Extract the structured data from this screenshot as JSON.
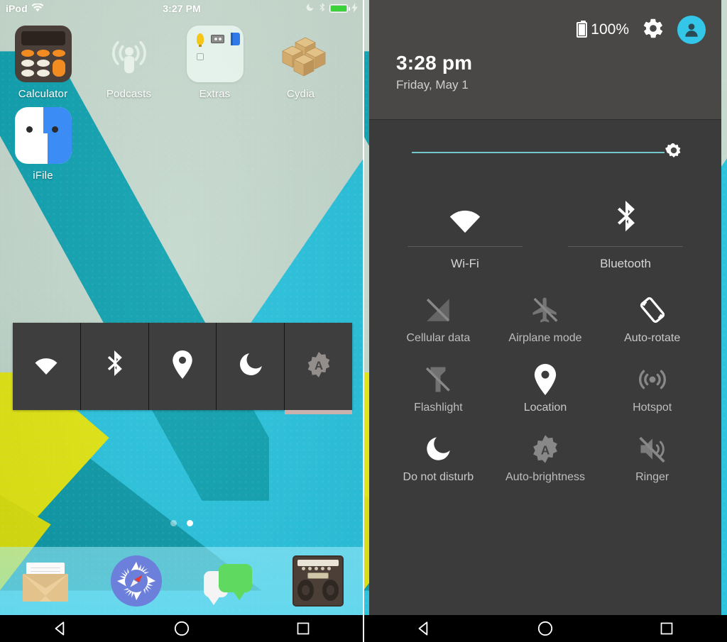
{
  "left_panel": {
    "status_bar": {
      "carrier": "iPod",
      "wifi_icon": "wifi-icon",
      "time": "3:27 PM",
      "dnd_icon": "crescent-moon-icon",
      "bluetooth_icon": "bluetooth-icon",
      "battery_icon": "battery-full-icon",
      "charging_icon": "lightning-bolt-icon"
    },
    "home_icons": [
      {
        "label": "Calculator",
        "icon": "calculator-icon"
      },
      {
        "label": "Podcasts",
        "icon": "podcasts-icon"
      },
      {
        "label": "Extras",
        "icon": "folder-icon"
      },
      {
        "label": "Cydia",
        "icon": "cydia-boxes-icon"
      },
      {
        "label": "iFile",
        "icon": "ifile-icon"
      }
    ],
    "folder_contents": [
      {
        "name": "lightbulb-icon"
      },
      {
        "name": "voice-memos-cassette-icon"
      },
      {
        "name": "ibooks-icon"
      },
      {
        "name": "empty-app-placeholder-icon"
      }
    ],
    "toggle_strip": [
      {
        "name": "wifi-toggle",
        "icon": "wifi-icon",
        "state": "on"
      },
      {
        "name": "bluetooth-toggle",
        "icon": "bluetooth-icon",
        "state": "on"
      },
      {
        "name": "location-toggle",
        "icon": "location-pin-icon",
        "state": "on"
      },
      {
        "name": "do-not-disturb-toggle",
        "icon": "crescent-moon-icon",
        "state": "on"
      },
      {
        "name": "auto-brightness-toggle",
        "icon": "auto-brightness-icon",
        "state": "off"
      }
    ],
    "page_dots": {
      "total": 2,
      "active_index": 1
    },
    "dock": [
      {
        "label": "Mail",
        "icon": "mail-envelope-icon"
      },
      {
        "label": "Safari",
        "icon": "safari-compass-icon"
      },
      {
        "label": "Messages",
        "icon": "messages-bubble-icon"
      },
      {
        "label": "Music",
        "icon": "boombox-radio-icon"
      }
    ]
  },
  "right_panel": {
    "header": {
      "battery_percent": "100%",
      "battery_icon": "battery-charging-icon",
      "settings_icon": "gear-icon",
      "avatar_icon": "user-avatar-icon",
      "time": "3:28 pm",
      "date": "Friday, May 1"
    },
    "brightness": {
      "name": "brightness-slider",
      "thumb_icon": "sun-icon",
      "value_percent": 93
    },
    "big_tiles": [
      {
        "label": "Wi-Fi",
        "icon": "wifi-icon",
        "state": "on"
      },
      {
        "label": "Bluetooth",
        "icon": "bluetooth-icon",
        "state": "on"
      }
    ],
    "tiles": [
      {
        "label": "Cellular data",
        "icon": "cellular-off-icon",
        "state": "off"
      },
      {
        "label": "Airplane mode",
        "icon": "airplane-off-icon",
        "state": "off"
      },
      {
        "label": "Auto-rotate",
        "icon": "auto-rotate-icon",
        "state": "on"
      },
      {
        "label": "Flashlight",
        "icon": "flashlight-off-icon",
        "state": "off"
      },
      {
        "label": "Location",
        "icon": "location-pin-icon",
        "state": "on"
      },
      {
        "label": "Hotspot",
        "icon": "hotspot-icon",
        "state": "off"
      },
      {
        "label": "Do not disturb",
        "icon": "crescent-moon-icon",
        "state": "on"
      },
      {
        "label": "Auto-brightness",
        "icon": "auto-brightness-icon",
        "state": "off"
      },
      {
        "label": "Ringer",
        "icon": "ringer-muted-icon",
        "state": "off"
      }
    ]
  },
  "nav_bar": [
    {
      "name": "back-button",
      "icon": "triangle-back-icon"
    },
    {
      "name": "home-button",
      "icon": "circle-home-icon"
    },
    {
      "name": "recents-button",
      "icon": "square-recents-icon"
    }
  ],
  "colors": {
    "wallpaper_sage": "#c6d9ce",
    "wallpaper_teal": "#12a2b0",
    "wallpaper_cyan": "#2bc3dd",
    "wallpaper_yellow": "#e0e515",
    "panel_dark": "#3b3b3b",
    "panel_header": "#494846",
    "accent_cyan": "#34c6e8",
    "slider_fill": "#73c6c9",
    "battery_green": "#3ad13a",
    "calculator_orange": "#f28c20"
  }
}
